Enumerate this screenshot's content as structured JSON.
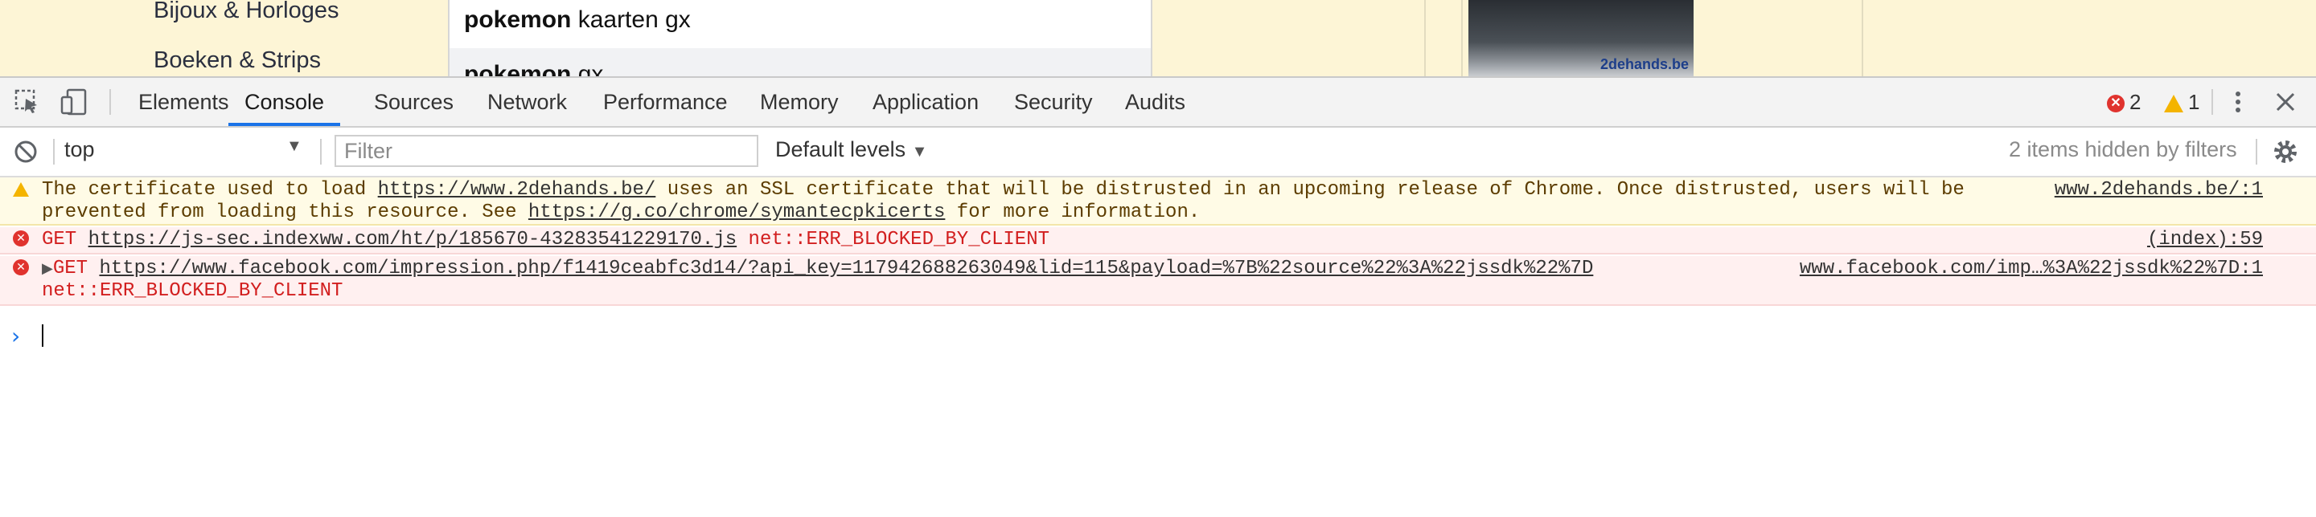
{
  "page": {
    "categories": [
      "Bijoux & Horloges",
      "Boeken & Strips"
    ],
    "suggestions": [
      {
        "bold": "pokemon",
        "rest": " kaarten gx"
      },
      {
        "bold": "pokemon",
        "rest": " gx"
      }
    ],
    "ad_brand": "2dehands.be"
  },
  "devtools": {
    "tabs": [
      "Elements",
      "Console",
      "Sources",
      "Network",
      "Performance",
      "Memory",
      "Application",
      "Security",
      "Audits"
    ],
    "active_tab": "Console",
    "error_count": "2",
    "warning_count": "1",
    "context": "top",
    "filter_placeholder": "Filter",
    "levels_label": "Default levels",
    "hidden_info": "2 items hidden by filters",
    "messages": {
      "warning": {
        "line1_pre": "The certificate used to load ",
        "line1_link": "https://www.2dehands.be/",
        "line1_post": " uses an SSL certificate that will be distrusted in an upcoming release of Chrome. Once distrusted, users will be",
        "line2_pre": "prevented from loading this resource. See ",
        "line2_link": "https://g.co/chrome/symantecpkicerts",
        "line2_post": " for more information.",
        "source": "www.2dehands.be/:1"
      },
      "error1": {
        "method": "GET ",
        "url": "https://js-sec.indexww.com/ht/p/185670-43283541229170.js",
        "error": " net::ERR_BLOCKED_BY_CLIENT",
        "source": "(index):59"
      },
      "error2": {
        "method": "GET ",
        "url": "https://www.facebook.com/impression.php/f1419ceabfc3d14/?api_key=117942688263049&lid=115&payload=%7B%22source%22%3A%22jssdk%22%7D",
        "error": "net::ERR_BLOCKED_BY_CLIENT",
        "source": "www.facebook.com/imp…%3A%22jssdk%22%7D:1"
      }
    },
    "prompt_symbol": "›"
  }
}
